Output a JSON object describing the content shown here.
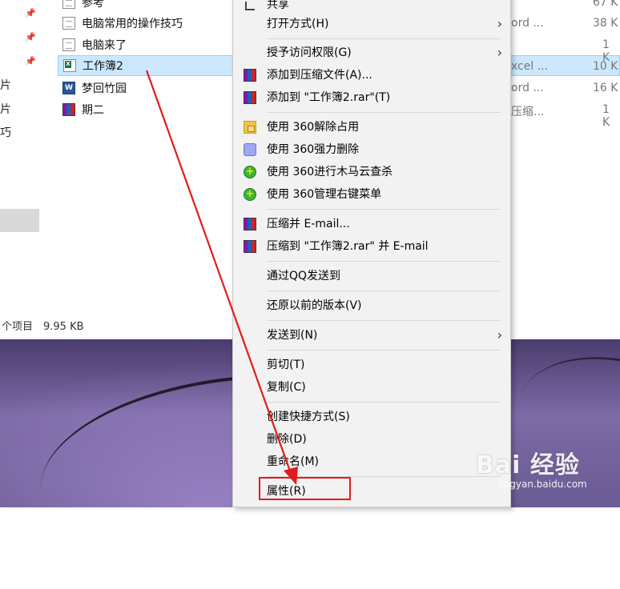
{
  "nav": {
    "labels": [
      "片",
      "片",
      "巧"
    ]
  },
  "files": [
    {
      "name": "参考",
      "icon": "word-doc-icon",
      "size": "67 K"
    },
    {
      "name": "电脑常用的操作技巧",
      "icon": "word-doc-icon",
      "type": "ord ...",
      "size": "38 K"
    },
    {
      "name": "电脑来了",
      "icon": "text-doc-icon",
      "size": "1 K"
    },
    {
      "name": "工作簿2",
      "icon": "excel-icon",
      "type": "xcel ...",
      "size": "10 K"
    },
    {
      "name": "梦回竹园",
      "icon": "word-icon",
      "type": "ord ...",
      "size": "16 K"
    },
    {
      "name": "期二",
      "icon": "rar-icon",
      "type": "压缩...",
      "size": "1 K"
    }
  ],
  "status": {
    "count": "个项目",
    "size": "9.95 KB"
  },
  "context_menu": {
    "share": "共享",
    "open_with": "打开方式(H)",
    "grant_access": "授予访问权限(G)",
    "add_archive": "添加到压缩文件(A)...",
    "add_to_rar": "添加到 \"工作簿2.rar\"(T)",
    "unlock_360": "使用 360解除占用",
    "force_delete_360": "使用 360强力删除",
    "scan_360": "使用 360进行木马云查杀",
    "manage_menu_360": "使用 360管理右键菜单",
    "compress_email": "压缩并 E-mail...",
    "compress_rar_email": "压缩到 \"工作簿2.rar\" 并 E-mail",
    "send_qq": "通过QQ发送到",
    "restore_previous": "还原以前的版本(V)",
    "send_to": "发送到(N)",
    "cut": "剪切(T)",
    "copy": "复制(C)",
    "create_shortcut": "创建快捷方式(S)",
    "delete": "删除(D)",
    "rename": "重命名(M)",
    "properties": "属性(R)"
  },
  "watermark": {
    "title": "Bai  经验",
    "url": "jingyan.baidu.com"
  },
  "colors": {
    "selection": "#cce8ff",
    "highlight": "#e31b1b"
  }
}
